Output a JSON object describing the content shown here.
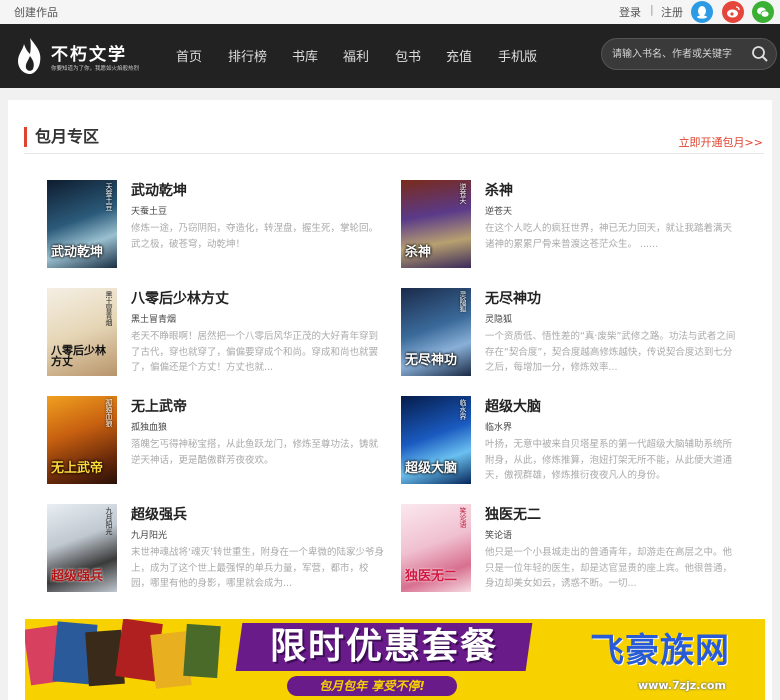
{
  "topbar": {
    "create": "创建作品",
    "login": "登录",
    "separator": "|",
    "register": "注册",
    "social": [
      "qq-icon",
      "weibo-icon",
      "wechat-icon"
    ]
  },
  "header": {
    "logo_name": "不朽文学",
    "logo_slogan": "你要知道为了你，我愿如火焰般热烈",
    "nav": [
      "首页",
      "排行榜",
      "书库",
      "福利",
      "包书",
      "充值",
      "手机版"
    ],
    "search_placeholder": "请输入书名、作者或关键字"
  },
  "section": {
    "title": "包月专区",
    "more": "立即开通包月>>",
    "accent_color": "#e0432f"
  },
  "books": [
    {
      "title": "武动乾坤",
      "author": "天蚕土豆",
      "desc": "修炼一途，乃窃阴阳，夺造化，转涅盘，握生死，掌轮回。武之极，破苍穹，动乾坤！",
      "cover_text": "武动乾坤",
      "cover_author": "天蚕土豆",
      "cover_color": "#1e3a5a"
    },
    {
      "title": "杀神",
      "author": "逆苍天",
      "desc": "在这个人吃人的疯狂世界，神已无力回天，就让我踏着满天诸神的累累尸骨来普渡这苍茫众生。 ......",
      "cover_text": "杀神",
      "cover_author": "逆苍天",
      "cover_color": "#4a2a6a"
    },
    {
      "title": "八零后少林方丈",
      "author": "黑土冒青烟",
      "desc": "老天不睁眼啊！居然把一个八零后风华正茂的大好青年穿到了古代，穿也就穿了，偏偏要穿成个和尚。穿成和尚也就罢了，偏偏还是个方丈！方丈也就...",
      "cover_text": "八零后少林方丈",
      "cover_author": "黑土冒青烟",
      "cover_color": "#d8c8a8"
    },
    {
      "title": "无尽神功",
      "author": "灵隐狐",
      "desc": "一个资质低、悟性差的“真·废柴”武修之路。功法与武者之间存在“契合度”，契合度越高修炼越快，传说契合度达到七分之后，每增加一分，修炼效率...",
      "cover_text": "无尽神功",
      "cover_author": "灵隐狐",
      "cover_color": "#2a4a78"
    },
    {
      "title": "无上武帝",
      "author": "孤独血狼",
      "desc": "落魄乞丐得神秘宝搭，从此鱼跃龙门，修炼至尊功法，铸就逆天神话，更是酷傲群芳夜夜欢。",
      "cover_text": "无上武帝",
      "cover_author": "孤独血狼",
      "cover_color": "#8a3a10"
    },
    {
      "title": "超级大脑",
      "author": "临水界",
      "desc": "叶扬，无意中被来自贝塔星系的第一代超级大脑辅助系统所附身，从此，修炼推算，泡妞打架无所不能，从此便大道通天，傲视群雄，修炼推衍夜夜凡人的身份。",
      "cover_text": "超级大脑",
      "cover_author": "临水界",
      "cover_color": "#0a3a8a"
    },
    {
      "title": "超级强兵",
      "author": "九月阳光",
      "desc": "末世神魂战将‘魂灭’转世重生，附身在一个卑微的陆家少爷身上，成为了这个世上最强悍的单兵力量，军营，都市，校园，哪里有他的身影，哪里就会成为...",
      "cover_text": "超级强兵",
      "cover_author": "九月阳光",
      "cover_color": "#c8d0d8"
    },
    {
      "title": "独医无二",
      "author": "笑论语",
      "desc": "他只是一个小县城走出的普通青年，却游走在高层之中。他只是一位年轻的医生，却是达官显贵的座上宾。他很普通，身边却美女如云，诱惑不断。一切...",
      "cover_text": "独医无二",
      "cover_author": "笑论语",
      "cover_color": "#f0d8e0"
    }
  ],
  "banner": {
    "main_text": "限时优惠套餐",
    "sub_text": "包月包年 享受不停!",
    "watermark": "飞豪族网",
    "watermark_url": "www.7zjz.com",
    "bg_color": "#f7d200",
    "accent_color": "#6a1b8a"
  }
}
